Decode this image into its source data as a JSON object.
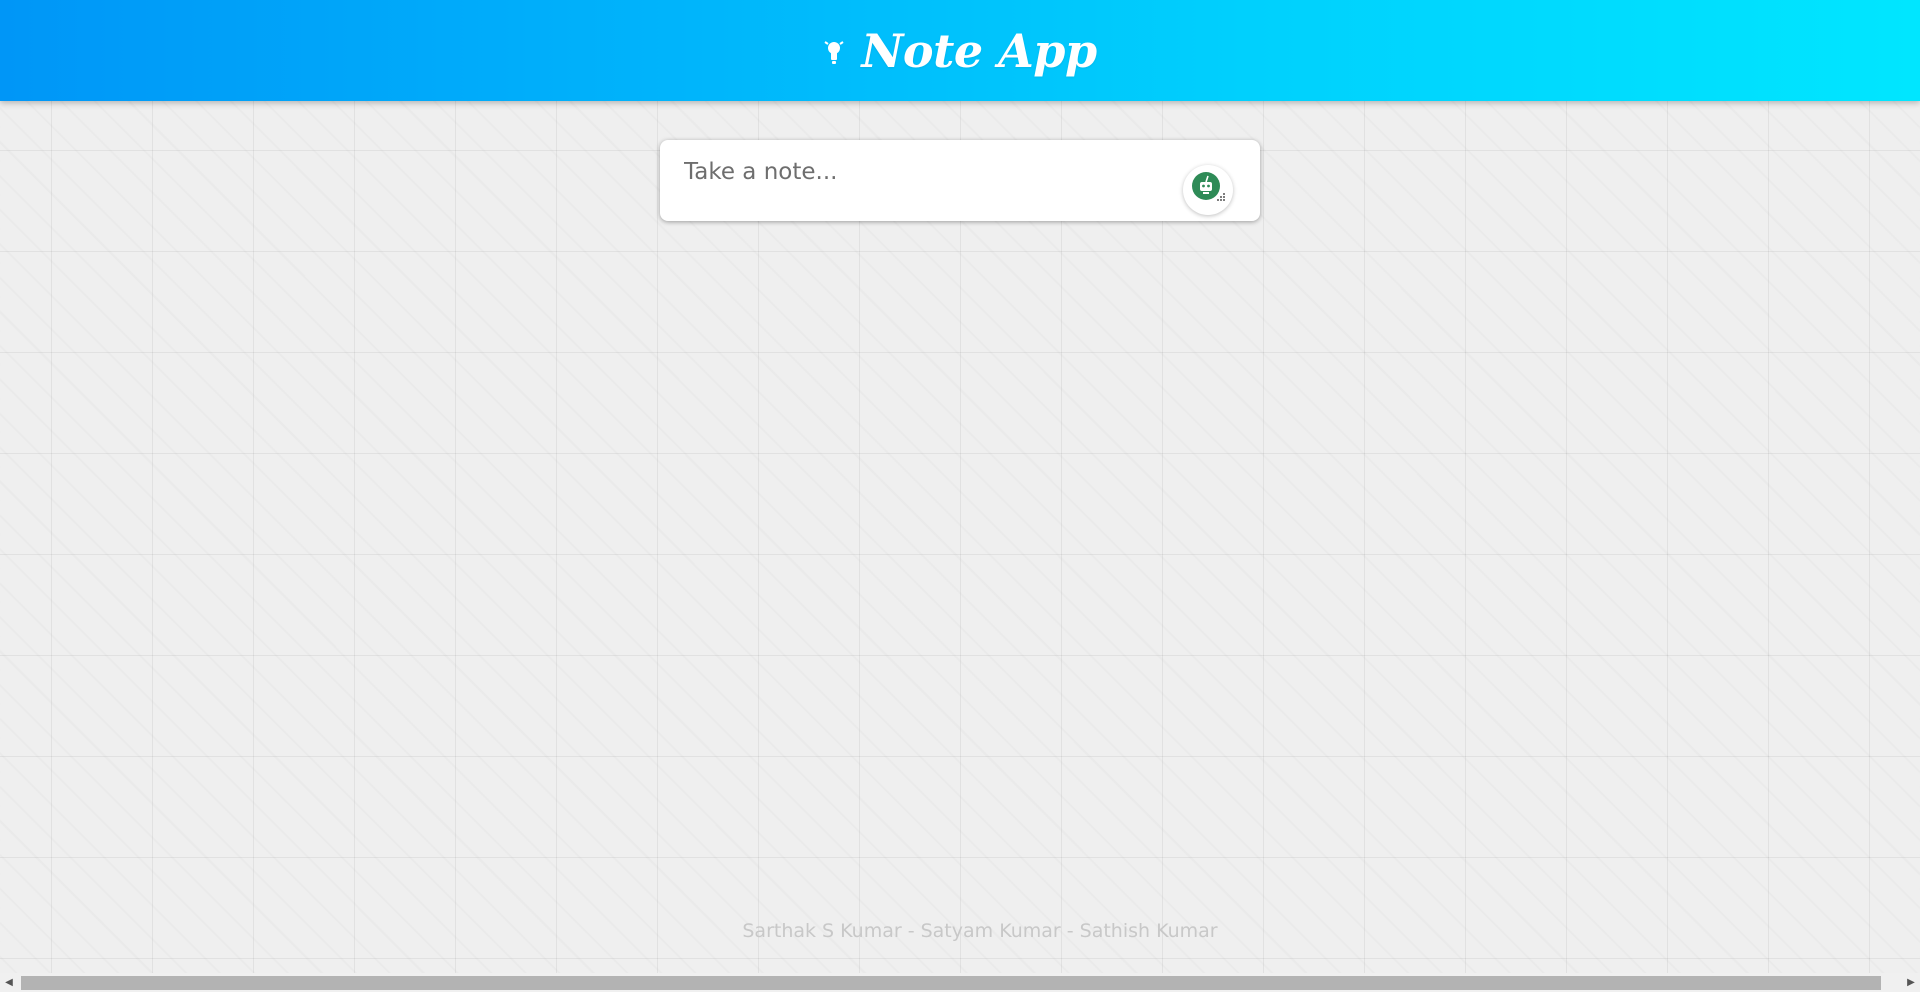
{
  "header": {
    "title": "Note App",
    "icon": "lightbulb-icon",
    "gradient": [
      "#0096f7",
      "#00e6ff"
    ]
  },
  "note": {
    "placeholder": "Take a note...",
    "value": "",
    "assistant_icon": "grammar-assistant-icon"
  },
  "footer": {
    "credits": "Sarthak S Kumar - Satyam Kumar - Sathish Kumar"
  },
  "scrollbar": {
    "left_arrow": "◀",
    "right_arrow": "▶"
  }
}
